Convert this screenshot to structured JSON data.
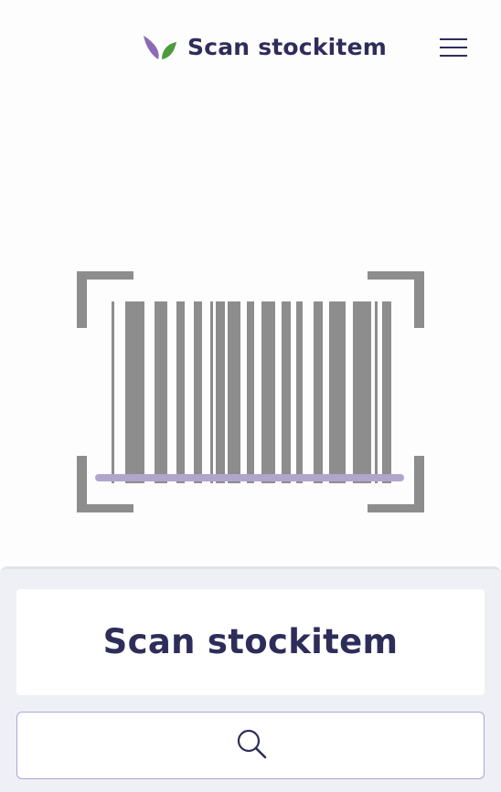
{
  "header": {
    "title": "Scan stockitem",
    "logo_icon": "leaf-logo-icon",
    "menu_icon": "hamburger-menu-icon"
  },
  "scanner": {
    "icon": "barcode-icon",
    "frame_color": "#8d8d8d",
    "scan_line_color": "#b1a5cc"
  },
  "panel": {
    "title": "Scan stockitem",
    "search_icon": "search-icon"
  },
  "colors": {
    "brand_text": "#2e2d5a",
    "leaf_purple": "#8b6bb8",
    "leaf_green": "#4e9a3d",
    "panel_bg": "#eef0f6",
    "input_border": "#a8a6d8"
  }
}
